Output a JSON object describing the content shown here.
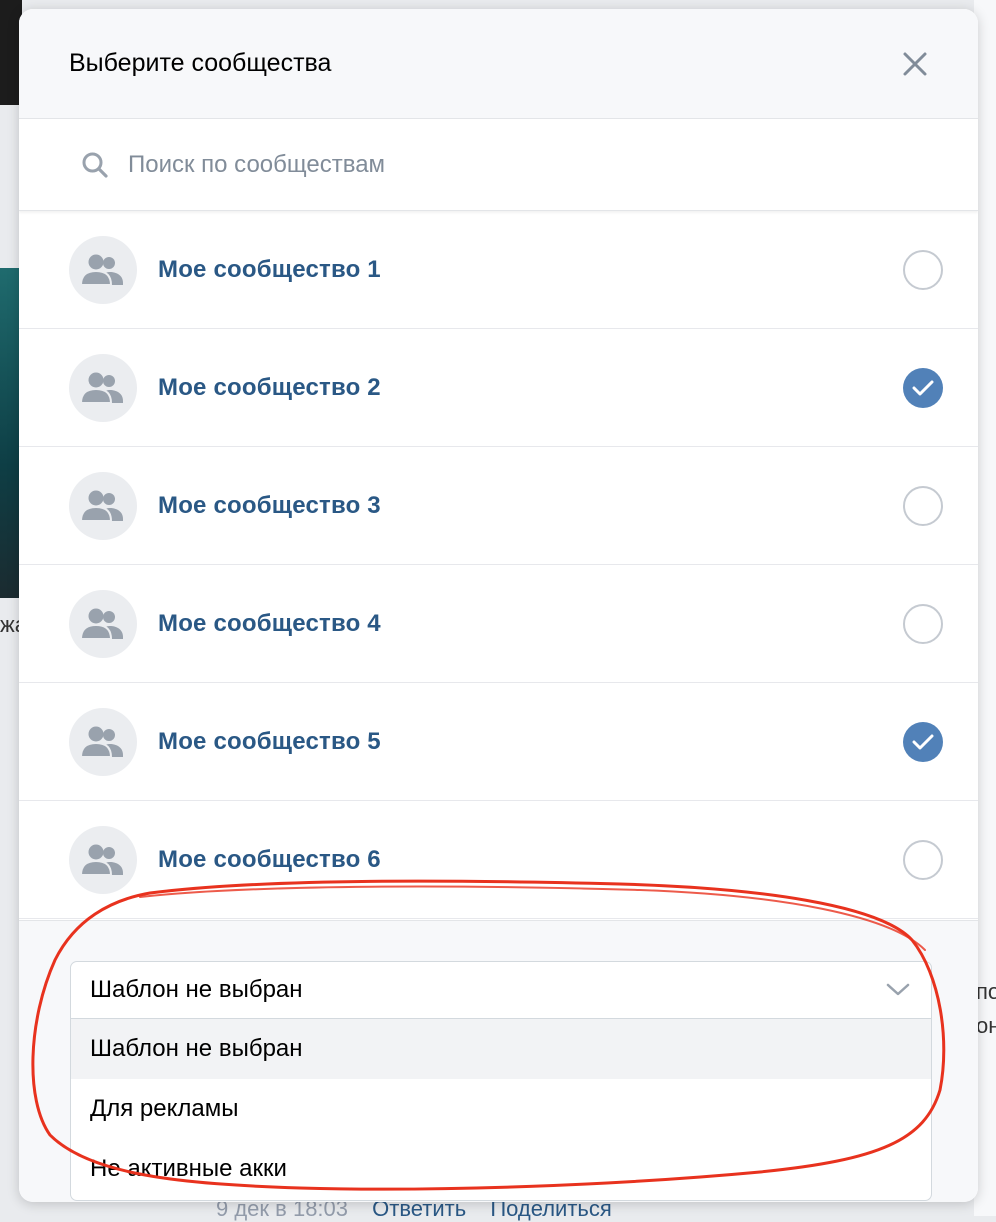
{
  "dialog": {
    "title": "Выберите сообщества",
    "close_icon": "close-icon"
  },
  "search": {
    "placeholder": "Поиск по сообществам",
    "value": "",
    "icon": "search-icon"
  },
  "communities": [
    {
      "label": "Мое сообщество 1",
      "checked": false
    },
    {
      "label": "Мое сообщество 2",
      "checked": true
    },
    {
      "label": "Мое сообщество 3",
      "checked": false
    },
    {
      "label": "Мое сообщество 4",
      "checked": false
    },
    {
      "label": "Мое сообщество 5",
      "checked": true
    },
    {
      "label": "Мое сообщество 6",
      "checked": false
    }
  ],
  "template_select": {
    "value": "Шаблон не выбран",
    "options": [
      "Шаблон не выбран",
      "Для рекламы",
      "Не активные акки"
    ],
    "selected_index": 0
  },
  "background": {
    "post_meta": [
      "9 дек в 18:03",
      "Ответить",
      "Поделиться"
    ],
    "left_fragment": "жа",
    "right_fragment": [
      "по",
      "он"
    ]
  },
  "colors": {
    "accent": "#5181b8",
    "link": "#2a5885",
    "annotation": "#e8321e"
  }
}
